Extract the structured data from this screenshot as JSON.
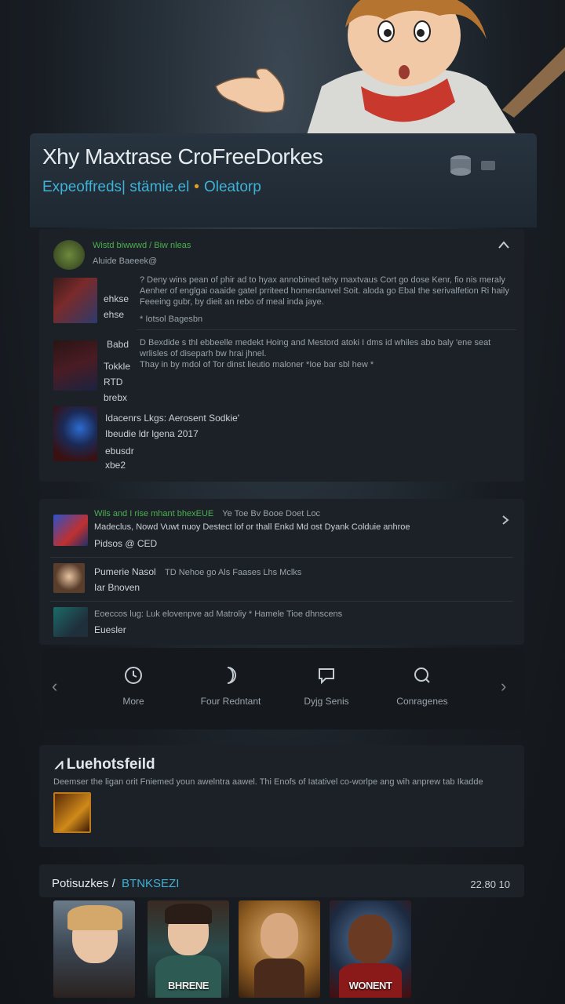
{
  "header": {
    "title": "Xhy Maxtrase CroFreeDorkes",
    "subtitle_left": "Expeoffreds| stämie.el",
    "subtitle_dot": "•",
    "subtitle_right": "Oleatorp"
  },
  "feed_card": {
    "heading": "Wistd biwwwd / Biw nleas",
    "subheading": "Aluide Baeeek@",
    "items": [
      {
        "labels": [
          "ehkse",
          "ehse"
        ],
        "text": "? Deny wins pean of phir ad to hyax annobined tehy maxtvaus Cort go dose Kenr, fio nis meraly Aenher of englgai oaaide gatel prriteed homerdanvel Soit. aloda go Ebal the serivalfetion Ri haily Feeeing gubr, by dieit an rebo of meal inda jaye.",
        "note": "* Iotsol Bagesbn"
      },
      {
        "labels": [
          "Babd",
          "Tokkle",
          "RTD",
          "brebx"
        ],
        "text": "D Bexdide s thl ebbeelle medekt Hoing and Mestord atoki I dms id whiles abo baly 'ene seat wrlisles of diseparh bw hrai jhnel.",
        "note": "Thay in by mdol of Tor dinst lieutio maloner *Ioe bar sbl hew *"
      },
      {
        "labels": [
          "Idacenrs Lkgs: Aerosent Sodkie'",
          "Ibeudie ldr lgena 2017",
          "ebusdr",
          "xbe2"
        ],
        "text": "",
        "note": ""
      }
    ]
  },
  "list_card": {
    "rows": [
      {
        "title": "Wils and I rise mhant bhexEUE",
        "title_suffix": "Ye Toe Bv Booe Doet Loc",
        "line2": "Madeclus, Nowd Vuwt nuoy Destect lof or thall Enkd Md ost Dyank Colduie anhroe",
        "line3": "Pidsos @ CED"
      },
      {
        "title": "Pumerie Nasol",
        "title_suffix": "TD Nehoe go Als Faases Lhs Mclks",
        "line2": "Iar Bnoven",
        "line3": ""
      },
      {
        "title": "Eoeccos lug: Luk elovenpve ad Matroliy * Hamele Tioe dhnscens",
        "title_suffix": "",
        "line2": "Euesler",
        "line3": ""
      }
    ]
  },
  "nav": {
    "items": [
      {
        "label": "More",
        "icon": "clock-icon"
      },
      {
        "label": "Four Redntant",
        "icon": "moon-icon"
      },
      {
        "label": "Dyjg Senis",
        "icon": "chat-icon"
      },
      {
        "label": "Conragenes",
        "icon": "search-icon"
      }
    ]
  },
  "info_card": {
    "title": "Luehotsfeild",
    "text": "Deemser the ligan orit Fniemed youn awelntra aawel. Thi Enofs of Iatativel co-worlpe ang wih anprew tab Ikadde"
  },
  "bottom_bar": {
    "title": "Potisuzkes /",
    "tag": "BTNKSEZI",
    "right": "22.80 10"
  },
  "posters": [
    {
      "label": ""
    },
    {
      "label": "BHRENE"
    },
    {
      "label": ""
    },
    {
      "label": "WONENT"
    }
  ],
  "colors": {
    "accent_blue": "#3fb2d6",
    "accent_green": "#4caf50",
    "accent_orange": "#e0a020"
  }
}
